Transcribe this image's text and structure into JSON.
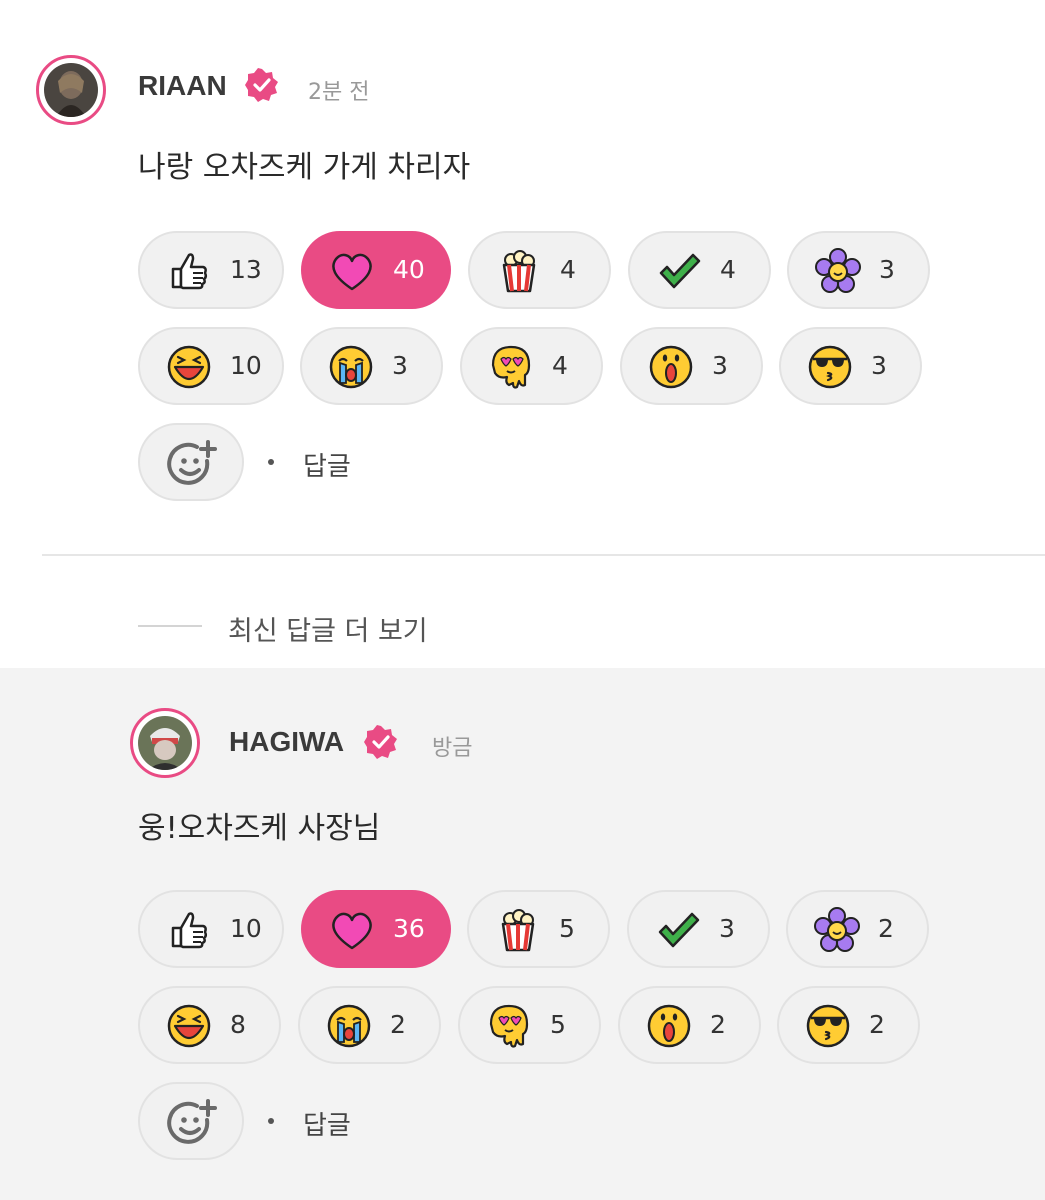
{
  "comments": [
    {
      "author": "RIAAN",
      "time": "2분 전",
      "text": "나랑 오차즈케 가게 차리자",
      "reactions": [
        "13",
        "40",
        "4",
        "4",
        "3",
        "10",
        "3",
        "4",
        "3",
        "3"
      ],
      "reply_label": "답글"
    },
    {
      "author": "HAGIWA",
      "time": "방금",
      "text": "웅!오차즈케 사장님",
      "reactions": [
        "10",
        "36",
        "5",
        "3",
        "2",
        "8",
        "2",
        "5",
        "2",
        "2"
      ],
      "reply_label": "답글"
    }
  ],
  "more_replies": "최신 답글 더 보기",
  "reaction_icons": [
    "thumbs-up-icon",
    "heart-icon",
    "popcorn-icon",
    "checkmark-icon",
    "flower-icon",
    "laughing-face-icon",
    "crying-face-icon",
    "heart-eyes-melting-icon",
    "surprised-face-icon",
    "sunglasses-kiss-icon"
  ],
  "active_reaction_index": 1,
  "colors": {
    "accent": "#e94b84",
    "chip_bg": "#f1f1f1",
    "reply_bg": "#f3f3f3"
  }
}
